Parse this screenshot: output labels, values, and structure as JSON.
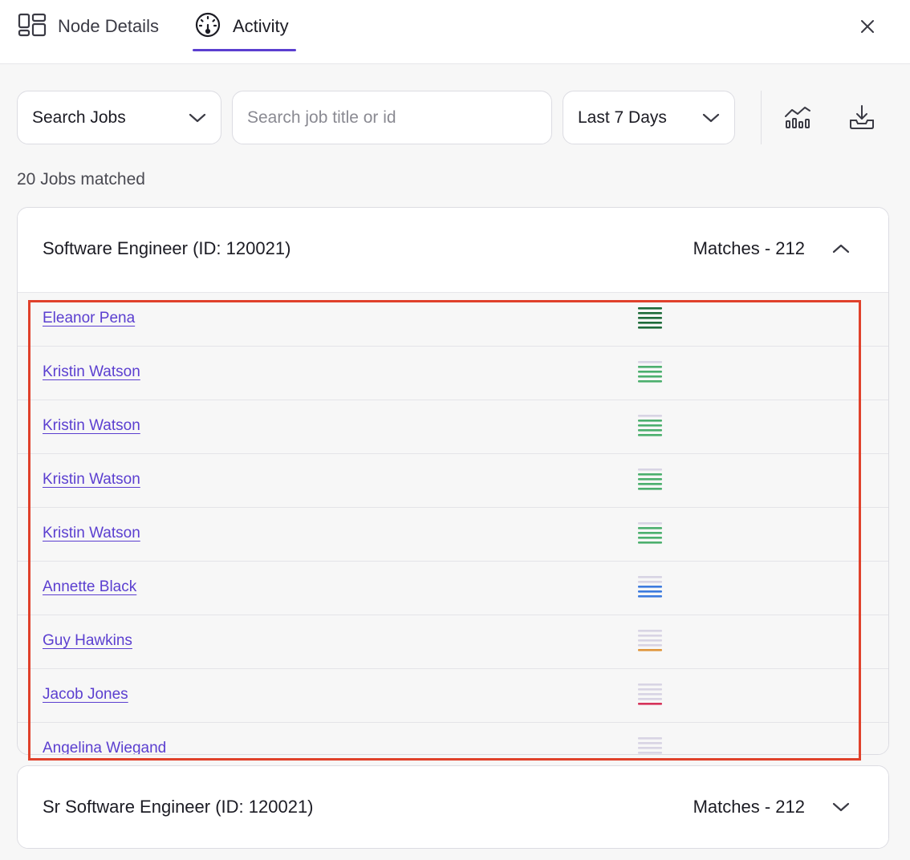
{
  "header": {
    "tabs": [
      {
        "label": "Node Details",
        "icon": "node-details-icon"
      },
      {
        "label": "Activity",
        "icon": "activity-gauge-icon",
        "active": true
      }
    ],
    "close_icon": "close-icon"
  },
  "filters": {
    "jobs_select": "Search Jobs",
    "search_placeholder": "Search job title or id",
    "date_range": "Last 7 Days",
    "chart_icon": "chart-icon",
    "download_icon": "download-icon"
  },
  "result_count": "20 Jobs matched",
  "jobs": [
    {
      "title": "Software Engineer (ID: 120021)",
      "matches": "Matches - 212",
      "expanded": true,
      "candidates": [
        {
          "name": "Eleanor Pena",
          "score": 5,
          "color": "#1e6b3a"
        },
        {
          "name": "Kristin Watson",
          "score": 4,
          "color": "#4caf6e"
        },
        {
          "name": "Kristin Watson",
          "score": 4,
          "color": "#4caf6e"
        },
        {
          "name": "Kristin Watson",
          "score": 4,
          "color": "#4caf6e"
        },
        {
          "name": "Kristin Watson",
          "score": 4,
          "color": "#4caf6e"
        },
        {
          "name": "Annette Black",
          "score": 3,
          "color": "#3d7bde"
        },
        {
          "name": "Guy Hawkins",
          "score": 1,
          "color": "#e0963c"
        },
        {
          "name": "Jacob Jones",
          "score": 1,
          "color": "#d6335a"
        },
        {
          "name": "Angelina Wiegand",
          "score": 0,
          "color": "#d8d4e4"
        }
      ]
    },
    {
      "title": "Sr Software Engineer (ID: 120021)",
      "matches": "Matches - 212",
      "expanded": false,
      "candidates": []
    }
  ]
}
